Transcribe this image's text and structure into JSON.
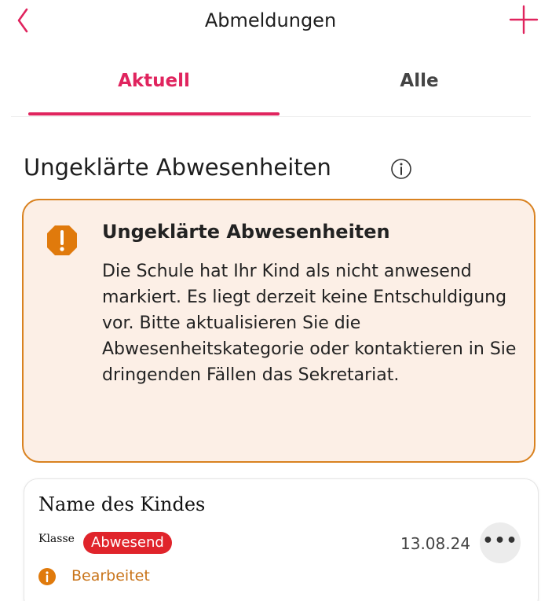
{
  "header": {
    "title": "Abmeldungen",
    "back_icon": "chevron-left-icon",
    "add_icon": "plus-icon"
  },
  "tabs": [
    {
      "label": "Aktuell",
      "active": true
    },
    {
      "label": "Alle",
      "active": false
    }
  ],
  "section": {
    "title": "Ungeklärte Abwesenheiten",
    "info_icon": "info-icon"
  },
  "warning": {
    "title": "Ungeklärte Abwesenheiten",
    "text": "Die Schule hat Ihr Kind als nicht anwesend markiert. Es liegt derzeit keine Entschuldigung vor. Bitte aktualisieren Sie die Abwesenheitskategorie oder kontaktieren in Sie dringenden Fällen das Sekretariat.",
    "icon": "exclamation-icon"
  },
  "entry": {
    "name": "Name des Kindes",
    "class_label": "Klasse",
    "status_badge": "Abwesend",
    "date": "13.08.24",
    "more_label": "•••",
    "edit_status": "Bearbeitet"
  },
  "colors": {
    "accent": "#e0245e",
    "warning_border": "#d98220",
    "warning_bg": "#fcefe6",
    "badge_bg": "#e0242b",
    "status_text": "#c9741a"
  }
}
